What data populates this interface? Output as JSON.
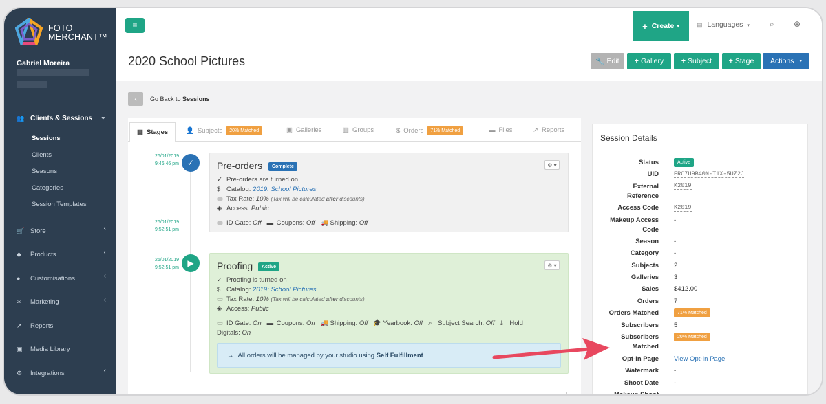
{
  "brand": {
    "line1": "FOTO",
    "line2": "MERCHANT™"
  },
  "user": {
    "name": "Gabriel Moreira"
  },
  "sidebar": {
    "group": {
      "label": "Clients & Sessions",
      "icon": "users-icon"
    },
    "subitems": [
      "Sessions",
      "Clients",
      "Seasons",
      "Categories",
      "Session Templates"
    ],
    "items": [
      {
        "label": "Store",
        "icon": "cart-icon"
      },
      {
        "label": "Products",
        "icon": "tag-icon"
      },
      {
        "label": "Customisations",
        "icon": "globe-icon"
      },
      {
        "label": "Marketing",
        "icon": "envelope-icon"
      },
      {
        "label": "Reports",
        "icon": "chart-icon"
      },
      {
        "label": "Media Library",
        "icon": "image-icon"
      },
      {
        "label": "Integrations",
        "icon": "plug-icon"
      }
    ]
  },
  "topbar": {
    "menu_icon": "≡",
    "create_label": "Create",
    "languages_label": "Languages"
  },
  "header": {
    "title": "2020 School Pictures",
    "buttons": {
      "edit": "Edit",
      "gallery": "Gallery",
      "subject": "Subject",
      "stage": "Stage",
      "actions": "Actions"
    }
  },
  "back": {
    "prefix": "Go Back to",
    "target": "Sessions"
  },
  "tabs": [
    {
      "label": "Stages",
      "badge": ""
    },
    {
      "label": "Subjects",
      "badge": "20% Matched"
    },
    {
      "label": "Galleries",
      "badge": ""
    },
    {
      "label": "Groups",
      "badge": ""
    },
    {
      "label": "Orders",
      "badge": "71% Matched"
    },
    {
      "label": "Files",
      "badge": ""
    },
    {
      "label": "Reports",
      "badge": ""
    }
  ],
  "stages": [
    {
      "date1": "26/01/2019",
      "time1": "9:46:46 pm",
      "date2": "26/01/2019",
      "time2": "9:52:51 pm",
      "title": "Pre-orders",
      "badge": "Complete",
      "line1": "Pre-orders are turned on",
      "catalog_label": "Catalog:",
      "catalog": "2019: School Pictures",
      "tax_label": "Tax Rate:",
      "tax": "10%",
      "tax_note_a": "(Tax will be calculated",
      "tax_note_b": "after",
      "tax_note_c": "discounts)",
      "access_label": "Access:",
      "access": "Public",
      "id_gate_label": "ID Gate:",
      "id_gate": "Off",
      "coupons_label": "Coupons:",
      "coupons": "Off",
      "shipping_label": "Shipping:",
      "shipping": "Off"
    },
    {
      "date1": "26/01/2019",
      "time1": "9:52:51 pm",
      "title": "Proofing",
      "badge": "Active",
      "line1": "Proofing is turned on",
      "catalog_label": "Catalog:",
      "catalog": "2019: School Pictures",
      "tax_label": "Tax Rate:",
      "tax": "10%",
      "tax_note_a": "(Tax will be calculated",
      "tax_note_b": "after",
      "tax_note_c": "discounts)",
      "access_label": "Access:",
      "access": "Public",
      "id_gate_label": "ID Gate:",
      "id_gate": "On",
      "coupons_label": "Coupons:",
      "coupons": "On",
      "shipping_label": "Shipping:",
      "shipping": "Off",
      "yearbook_label": "Yearbook:",
      "yearbook": "Off",
      "subject_search_label": "Subject Search:",
      "subject_search": "Off",
      "hold_label": "Hold",
      "digitals_label": "Digitals:",
      "digitals": "On",
      "info_a": "All orders will be managed by your studio using",
      "info_b": "Self Fulfillment",
      "info_c": "."
    }
  ],
  "details": {
    "title": "Session Details",
    "status_label": "Status",
    "status": "Active",
    "uid_label": "UID",
    "uid": "ERC7U9B40N-T1X-5UZ2J",
    "extref_label_1": "External",
    "extref_label_2": "Reference",
    "extref": "K2019",
    "access_code_label": "Access Code",
    "access_code": "K2019",
    "makeup_label_1": "Makeup Access",
    "makeup_label_2": "Code",
    "makeup": "-",
    "season_label": "Season",
    "season": "-",
    "category_label": "Category",
    "category": "-",
    "subjects_label": "Subjects",
    "subjects": "2",
    "galleries_label": "Galleries",
    "galleries": "3",
    "sales_label": "Sales",
    "sales": "$412.00",
    "orders_label": "Orders",
    "orders": "7",
    "orders_matched_label": "Orders Matched",
    "orders_matched": "71% Matched",
    "subscribers_label": "Subscribers",
    "subscribers": "5",
    "subs_matched_label_1": "Subscribers",
    "subs_matched_label_2": "Matched",
    "subs_matched": "20% Matched",
    "optin_label": "Opt-In Page",
    "optin": "View Opt-In Page",
    "watermark_label": "Watermark",
    "watermark": "-",
    "shoot_label": "Shoot Date",
    "shoot": "-",
    "makeup_shoot_label": "Makeup Shoot",
    "makeup_shoot": "-"
  },
  "colors": {
    "sidebar": "#2d3e50",
    "accent": "#1fa586",
    "primary": "#2a72b5",
    "warning": "#f0a041",
    "arrow": "#e8485f"
  }
}
